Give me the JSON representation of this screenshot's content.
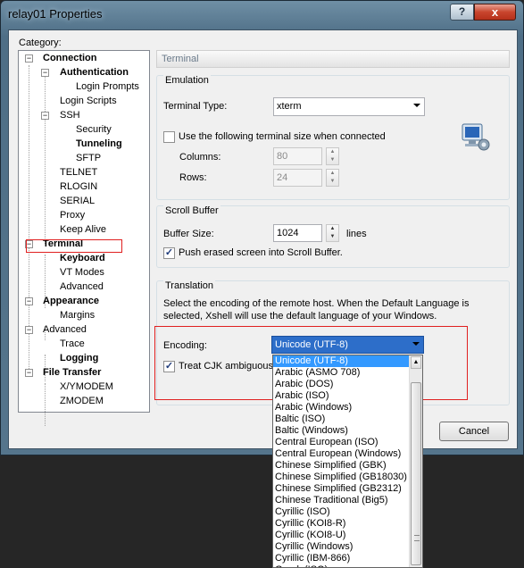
{
  "window": {
    "title": "relay01 Properties",
    "help_glyph": "?",
    "close_glyph": "x"
  },
  "category_label": "Category:",
  "tree": {
    "connection": "Connection",
    "authentication": "Authentication",
    "login_prompts": "Login Prompts",
    "login_scripts": "Login Scripts",
    "ssh": "SSH",
    "security": "Security",
    "tunneling": "Tunneling",
    "sftp": "SFTP",
    "telnet": "TELNET",
    "rlogin": "RLOGIN",
    "serial": "SERIAL",
    "proxy": "Proxy",
    "keep_alive": "Keep Alive",
    "terminal": "Terminal",
    "keyboard": "Keyboard",
    "vt_modes": "VT Modes",
    "advanced_terminal": "Advanced",
    "appearance": "Appearance",
    "margins": "Margins",
    "advanced": "Advanced",
    "trace": "Trace",
    "logging": "Logging",
    "file_transfer": "File Transfer",
    "xymodem": "X/YMODEM",
    "zmodem": "ZMODEM"
  },
  "page_header": "Terminal",
  "emulation": {
    "title": "Emulation",
    "terminal_type_label": "Terminal Type:",
    "terminal_type_value": "xterm",
    "use_size_label": "Use the following terminal size when connected",
    "columns_label": "Columns:",
    "columns_value": "80",
    "rows_label": "Rows:",
    "rows_value": "24"
  },
  "scroll_buffer": {
    "title": "Scroll Buffer",
    "size_label": "Buffer Size:",
    "size_value": "1024",
    "unit": "lines",
    "push_label": "Push erased screen into Scroll Buffer."
  },
  "translation": {
    "title": "Translation",
    "description_line1": "Select the encoding of the remote host. When the Default Language is",
    "description_line2": "selected, Xshell will use the default language of your Windows.",
    "encoding_label": "Encoding:",
    "encoding_value": "Unicode (UTF-8)",
    "cjk_label": "Treat CJK ambiguous c"
  },
  "buttons": {
    "cancel": "Cancel"
  },
  "encoding_options": [
    "Unicode (UTF-8)",
    "Arabic (ASMO 708)",
    "Arabic (DOS)",
    "Arabic (ISO)",
    "Arabic (Windows)",
    "Baltic (ISO)",
    "Baltic (Windows)",
    "Central European (ISO)",
    "Central European (Windows)",
    "Chinese Simplified (GBK)",
    "Chinese Simplified (GB18030)",
    "Chinese Simplified (GB2312)",
    "Chinese Traditional (Big5)",
    "Cyrillic (ISO)",
    "Cyrillic (KOI8-R)",
    "Cyrillic (KOI8-U)",
    "Cyrillic (Windows)",
    "Cyrillic (IBM-866)",
    "Greek (ISO)"
  ],
  "colors": {
    "selection": "#3399ff",
    "highlight_box": "#e02020",
    "combo_active": "#2d6ec9"
  }
}
